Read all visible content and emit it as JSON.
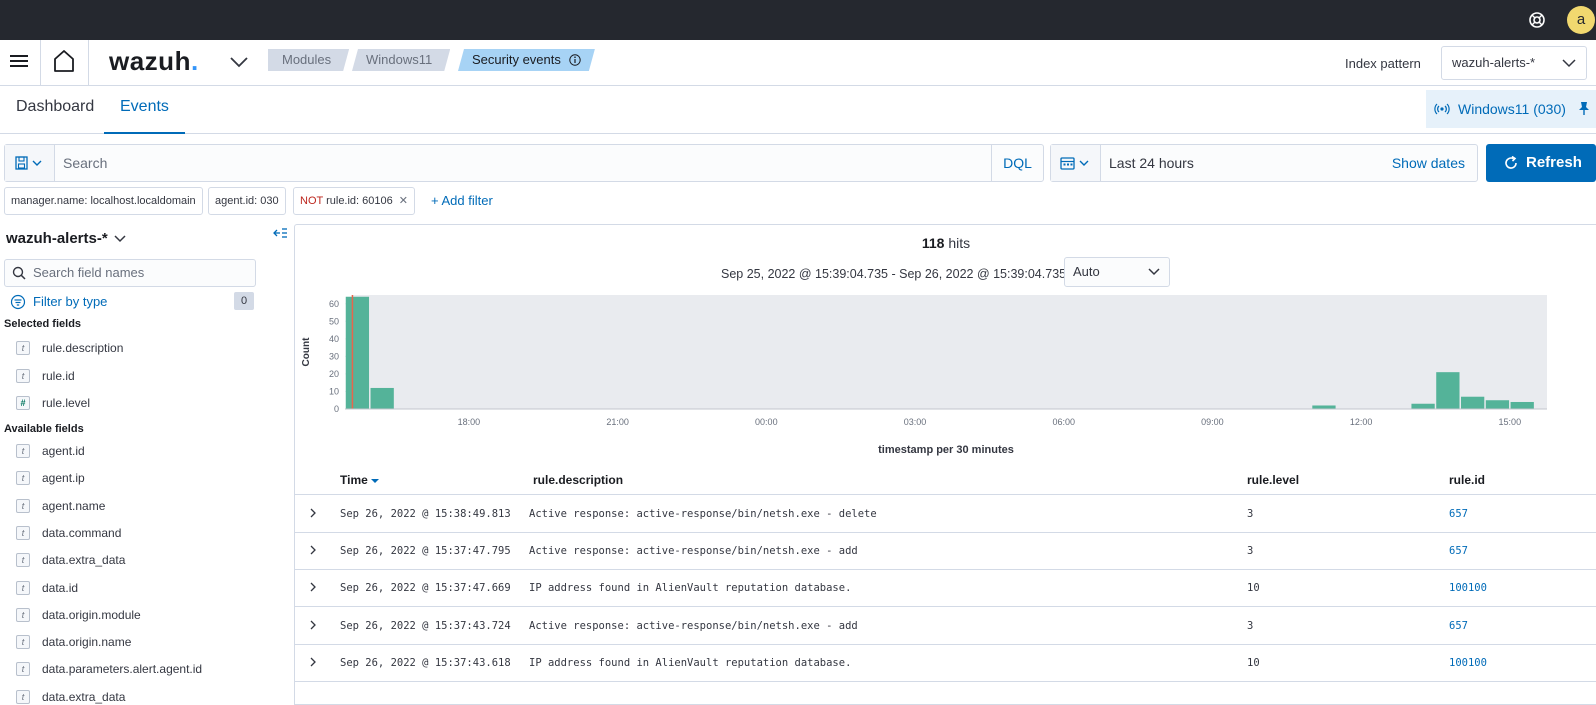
{
  "topbar": {
    "avatar_letter": "a"
  },
  "header": {
    "logo": "wazuh",
    "logo_dot": ".",
    "breadcrumbs": [
      "Modules",
      "Windows11",
      "Security events"
    ],
    "index_pattern_label": "Index pattern",
    "index_pattern_value": "wazuh-alerts-*"
  },
  "tabs": [
    "Dashboard",
    "Events"
  ],
  "agent_pill": "Windows11 (030)",
  "query": {
    "placeholder": "Search",
    "language": "DQL"
  },
  "date": {
    "range": "Last 24 hours",
    "show_dates": "Show dates",
    "refresh": "Refresh"
  },
  "filters": [
    {
      "text": "manager.name: localhost.localdomain"
    },
    {
      "text": "agent.id: 030"
    },
    {
      "neg": "NOT",
      "text": "rule.id: 60106"
    }
  ],
  "add_filter": "+ Add filter",
  "sidebar": {
    "index": "wazuh-alerts-*",
    "search_placeholder": "Search field names",
    "filter_by_type": "Filter by type",
    "filter_count": "0",
    "selected_title": "Selected fields",
    "selected_fields": [
      {
        "type": "t",
        "name": "rule.description"
      },
      {
        "type": "t",
        "name": "rule.id"
      },
      {
        "type": "#",
        "name": "rule.level"
      }
    ],
    "available_title": "Available fields",
    "available_fields": [
      {
        "type": "t",
        "name": "agent.id"
      },
      {
        "type": "t",
        "name": "agent.ip"
      },
      {
        "type": "t",
        "name": "agent.name"
      },
      {
        "type": "t",
        "name": "data.command"
      },
      {
        "type": "t",
        "name": "data.extra_data"
      },
      {
        "type": "t",
        "name": "data.id"
      },
      {
        "type": "t",
        "name": "data.origin.module"
      },
      {
        "type": "t",
        "name": "data.origin.name"
      },
      {
        "type": "t",
        "name": "data.parameters.alert.agent.id"
      },
      {
        "type": "t",
        "name": "data.extra_data"
      }
    ]
  },
  "histogram": {
    "hits_count": "118",
    "hits_label": "hits",
    "range": "Sep 25, 2022 @ 15:39:04.735 - Sep 26, 2022 @ 15:39:04.735",
    "interval": "Auto"
  },
  "chart_data": {
    "type": "bar",
    "title": "",
    "xlabel": "timestamp per 30 minutes",
    "ylabel": "Count",
    "ylim": [
      0,
      65
    ],
    "yticks": [
      0,
      10,
      20,
      30,
      40,
      50,
      60
    ],
    "xticks": [
      "18:00",
      "21:00",
      "00:00",
      "03:00",
      "06:00",
      "09:00",
      "12:00",
      "15:00"
    ],
    "x_start_hour": 15.5,
    "x_end_hour": 39.75,
    "bar_color": "#54b399",
    "now_line_color": "#e7664c",
    "bars": [
      {
        "start": "11:00",
        "count": 2
      },
      {
        "start": "13:00",
        "count": 3
      },
      {
        "start": "13:30",
        "count": 21
      },
      {
        "start": "14:00",
        "count": 7
      },
      {
        "start": "14:30",
        "count": 5
      },
      {
        "start": "15:00",
        "count": 4
      },
      {
        "start": "15:30",
        "count": 64
      },
      {
        "start": "16:00",
        "count": 12
      }
    ],
    "now": "15:39"
  },
  "table": {
    "columns": [
      "Time",
      "rule.description",
      "rule.level",
      "rule.id"
    ],
    "rows": [
      {
        "time": "Sep 26, 2022 @ 15:38:49.813",
        "description": "Active response: active-response/bin/netsh.exe - delete",
        "level": "3",
        "id": "657"
      },
      {
        "time": "Sep 26, 2022 @ 15:37:47.795",
        "description": "Active response: active-response/bin/netsh.exe - add",
        "level": "3",
        "id": "657"
      },
      {
        "time": "Sep 26, 2022 @ 15:37:47.669",
        "description": "IP address found in AlienVault reputation database.",
        "level": "10",
        "id": "100100"
      },
      {
        "time": "Sep 26, 2022 @ 15:37:43.724",
        "description": "Active response: active-response/bin/netsh.exe - add",
        "level": "3",
        "id": "657"
      },
      {
        "time": "Sep 26, 2022 @ 15:37:43.618",
        "description": "IP address found in AlienVault reputation database.",
        "level": "10",
        "id": "100100"
      }
    ]
  }
}
